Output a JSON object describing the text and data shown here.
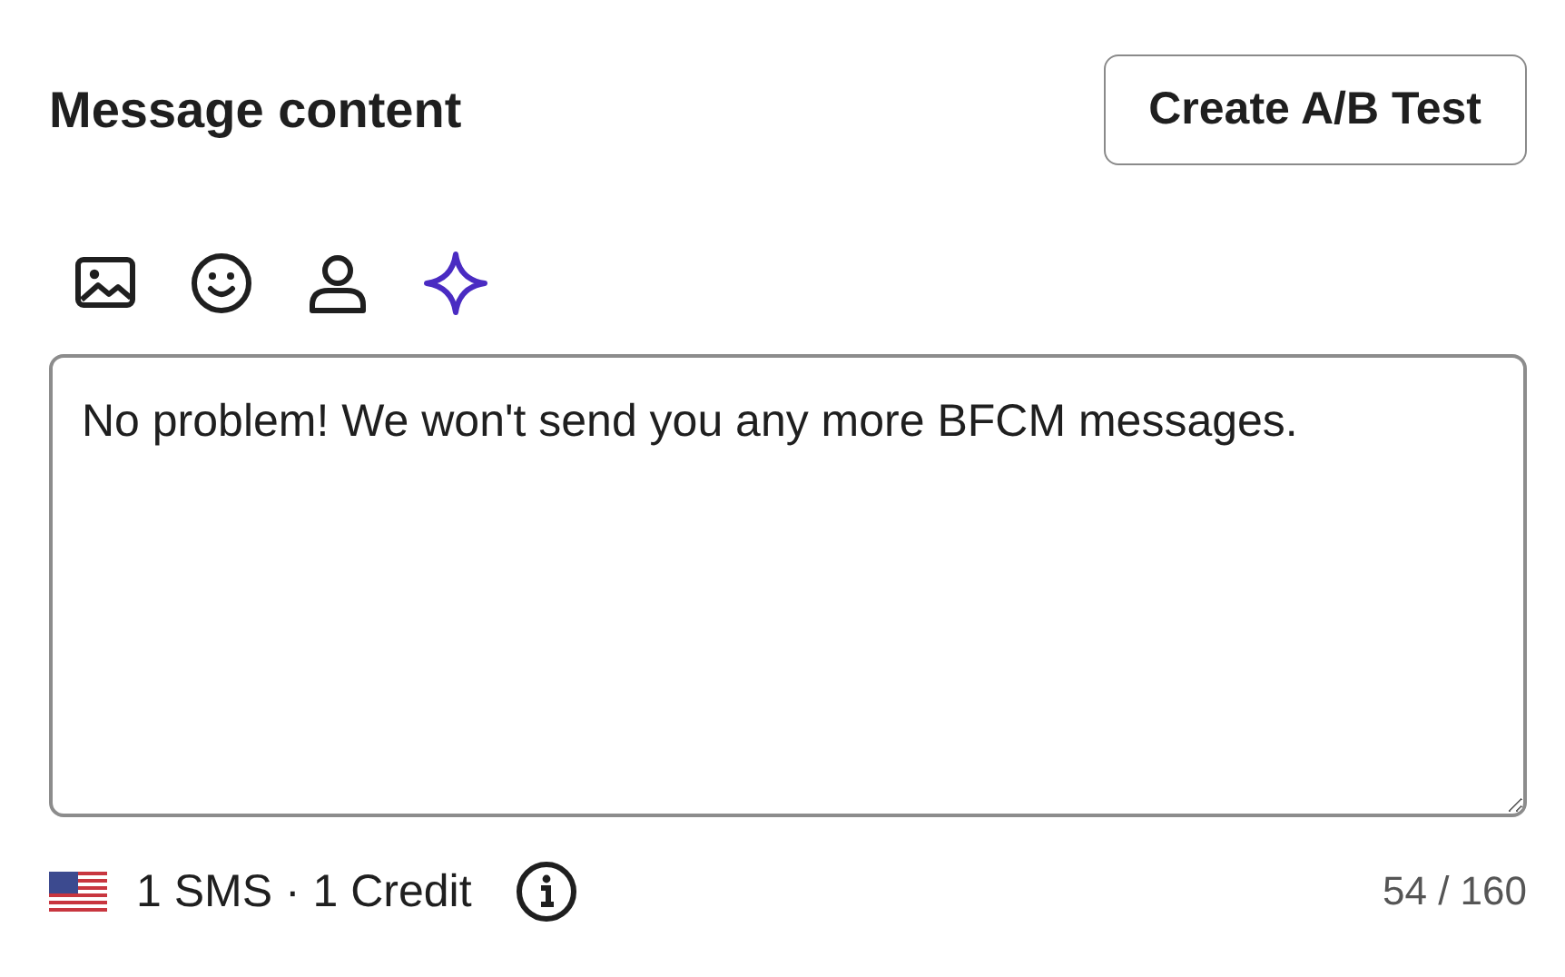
{
  "header": {
    "title": "Message content",
    "ab_button": "Create A/B Test"
  },
  "editor": {
    "value": "No problem! We won't send you any more BFCM messages."
  },
  "footer": {
    "segments": "1 SMS · 1 Credit",
    "count": "54 / 160"
  }
}
